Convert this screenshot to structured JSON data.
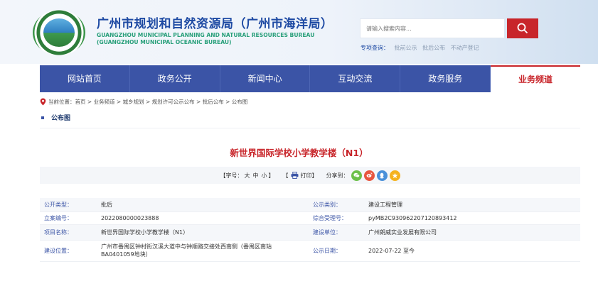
{
  "header": {
    "title_cn": "广州市规划和自然资源局（广州市海洋局）",
    "title_en_line1": "GUANGZHOU MUNICIPAL PLANNING AND NATURAL RESOURCES BUREAU",
    "title_en_line2": "(GUANGZHOU MUNICIPAL OCEANIC BUREAU)",
    "search_placeholder": "请输入搜索内容...",
    "special_label": "专项查询：",
    "special_links": [
      "批前公示",
      "批后公布",
      "不动产登记"
    ]
  },
  "nav": {
    "items": [
      "网站首页",
      "政务公开",
      "新闻中心",
      "互动交流",
      "政务服务",
      "业务频道"
    ],
    "active_index": 5
  },
  "breadcrumb": {
    "label": "当前位置：",
    "path": "首页 > 业务频道 > 城乡规划 > 规划许可公示公布 > 批后公布 > 公布图"
  },
  "section": {
    "title": "公布图"
  },
  "article": {
    "title": "新世界国际学校小学教学楼（N1）"
  },
  "toolbar": {
    "font_label": "【字号：",
    "font_large": "大",
    "font_medium": "中",
    "font_small": "小",
    "font_close": "】",
    "print_open": "【",
    "print_label": "打印",
    "print_close": "】",
    "share_label": "分享到：",
    "share_icons": [
      "wechat-icon",
      "weibo-icon",
      "qq-icon",
      "qzone-icon"
    ],
    "colors": {
      "wechat": "#6cc04a",
      "weibo": "#e8563f",
      "qq": "#4a90d9",
      "qzone": "#f5b21d"
    }
  },
  "info": {
    "rows": [
      {
        "l1": "公开类型：",
        "v1": "批后",
        "l2": "公示类别：",
        "v2": "建设工程管理"
      },
      {
        "l1": "立案编号：",
        "v1": "2022080000023888",
        "l2": "综合受理号：",
        "v2": "pyMB2C930962207120893412"
      },
      {
        "l1": "项目名称：",
        "v1": "新世界国际学校小学教学楼（N1）",
        "l2": "建设单位：",
        "v2": "广州朗威实业发展有限公司"
      },
      {
        "l1": "建设位置：",
        "v1": "广州市番禺区钟村街汉溪大道中与钟顺路交接处西南侧（番禺区南站BA0401059地块）",
        "l2": "公示日期：",
        "v2": "2022-07-22 至今"
      }
    ]
  },
  "colors": {
    "brand_blue": "#3b54a6",
    "accent_red": "#c8252a",
    "title_blue": "#1e4aa3",
    "en_green": "#2aa07b"
  }
}
